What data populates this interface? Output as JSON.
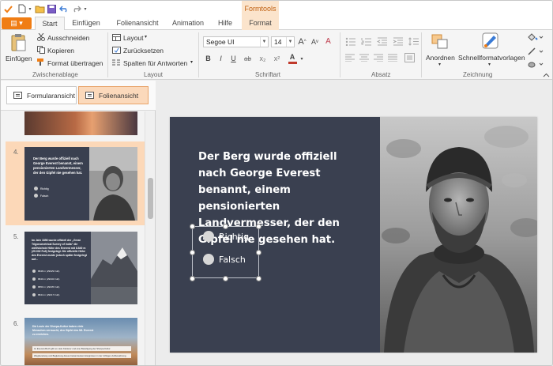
{
  "title_bar": {
    "contextual_tab": "Formtools"
  },
  "tabs": {
    "file_button": "▤ ▾",
    "items": [
      "Start",
      "Einfügen",
      "Folienansicht",
      "Animation",
      "Hilfe",
      "Format"
    ]
  },
  "ribbon": {
    "clipboard": {
      "paste": "Einfügen",
      "cut": "Ausschneiden",
      "copy": "Kopieren",
      "format_painter": "Format übertragen",
      "group": "Zwischenablage"
    },
    "layout": {
      "layout": "Layout",
      "reset": "Zurücksetzen",
      "columns": "Spalten für Antworten",
      "group": "Layout"
    },
    "font": {
      "font_name": "Segoe UI",
      "font_size": "14",
      "bold": "B",
      "italic": "I",
      "underline": "U",
      "strike": "ab",
      "subscript": "x₂",
      "superscript": "x²",
      "color": "A",
      "grow": "A",
      "shrink": "A",
      "clear": "A",
      "group": "Schriftart"
    },
    "paragraph": {
      "group": "Absatz"
    },
    "drawing": {
      "arrange": "Anordnen",
      "quick_styles": "Schnellformatvorlagen",
      "group": "Zeichnung"
    },
    "accent_color": "#f07d14"
  },
  "left_panel": {
    "form_view": "Formularansicht",
    "slide_view": "Folienansicht",
    "slides": [
      {
        "number": "4.",
        "text": "Der Berg wurde offiziell nach George Everest benannt, einem pensionierten Landvermesser, der den Gipfel nie gesehen hat.",
        "options": [
          "Richtig",
          "Falsch"
        ]
      },
      {
        "number": "5.",
        "text": "Im Jahr 1856 wurde offiziell der „Great Trigonometrical Survey of India“ die welthöchste Höhe des Everest mit 8.840 m (29.002 Fuß) festgelegt. Die offizielle Höhe des Everest wurde jedoch später festgelegt auf...",
        "options": [
          "8848 m (29029 Fuß)",
          "8849 m (29032 Fuß)",
          "8850 m (29035 Fuß)",
          "8844 m (29017 Fuß)"
        ]
      },
      {
        "number": "6.",
        "text": "Die Leute der Sherpa-Kultur haben viele Menschen verraucht, den Gipfel des Mt. Everest zu erreichen.",
        "options": [
          "Im Everest-Buch gibt es viele Kletterer und eine Beteiligung der Sherpa-Kultur",
          "Wegbereitung und Begleitung dieses bekanntesten Ereignissen in der richtigen Aufbewahrung."
        ]
      }
    ]
  },
  "slide": {
    "question": "Der Berg wurde offiziell nach George Everest benannt, einem pensionierten Landvermesser, der den Gipfel nie gesehen hat.",
    "options": [
      "Richtig",
      "Falsch"
    ],
    "background": "#3a4050"
  }
}
